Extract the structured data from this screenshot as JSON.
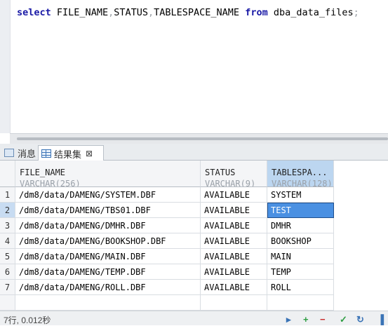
{
  "editor": {
    "keyword_select": "select",
    "col1": "FILE_NAME",
    "col2": "STATUS",
    "col3": "TABLESPACE_NAME",
    "keyword_from": "from",
    "table": "dba_data_files",
    "terminator": ";"
  },
  "tabs": [
    {
      "label": "消息",
      "icon": "message-icon"
    },
    {
      "label": "结果集",
      "icon": "table-icon",
      "close": "⊠"
    }
  ],
  "columns": [
    {
      "name": "FILE_NAME",
      "type": "VARCHAR(256)"
    },
    {
      "name": "STATUS",
      "type": "VARCHAR(9)"
    },
    {
      "name": "TABLESPA...",
      "type": "VARCHAR(128)"
    }
  ],
  "rows": [
    {
      "n": "1",
      "file": "/dm8/data/DAMENG/SYSTEM.DBF",
      "status": "AVAILABLE",
      "ts": "SYSTEM"
    },
    {
      "n": "2",
      "file": "/dm8/data/DAMENG/TBS01.DBF",
      "status": "AVAILABLE",
      "ts": "TEST"
    },
    {
      "n": "3",
      "file": "/dm8/data/DAMENG/DMHR.DBF",
      "status": "AVAILABLE",
      "ts": "DMHR"
    },
    {
      "n": "4",
      "file": "/dm8/data/DAMENG/BOOKSHOP.DBF",
      "status": "AVAILABLE",
      "ts": "BOOKSHOP"
    },
    {
      "n": "5",
      "file": "/dm8/data/DAMENG/MAIN.DBF",
      "status": "AVAILABLE",
      "ts": "MAIN"
    },
    {
      "n": "6",
      "file": "/dm8/data/DAMENG/TEMP.DBF",
      "status": "AVAILABLE",
      "ts": "TEMP"
    },
    {
      "n": "7",
      "file": "/dm8/data/DAMENG/ROLL.DBF",
      "status": "AVAILABLE",
      "ts": "ROLL"
    }
  ],
  "status": {
    "text": "7行, 0.012秒"
  },
  "colors": {
    "keyword": "#1a1aa6",
    "selection": "#4a90e2",
    "header_selected": "#bcd6f0"
  }
}
